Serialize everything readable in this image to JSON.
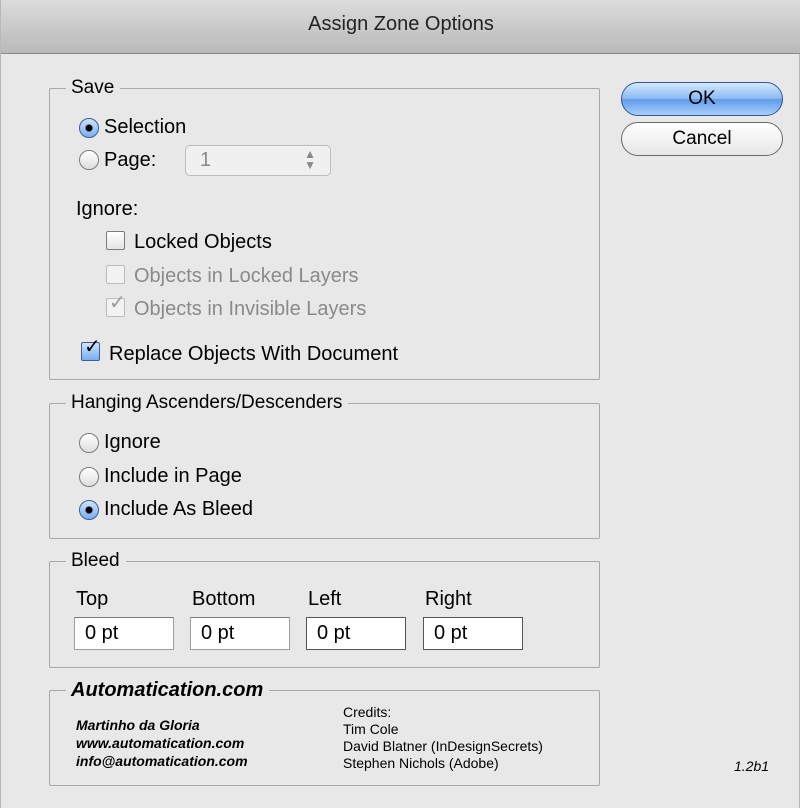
{
  "window": {
    "title": "Assign Zone Options"
  },
  "buttons": {
    "ok": "OK",
    "cancel": "Cancel"
  },
  "save_group": {
    "legend": "Save",
    "selection_label": "Selection",
    "selection_checked": true,
    "page_label": "Page:",
    "page_checked": false,
    "page_value": "1",
    "ignore_label": "Ignore:",
    "locked_objects": {
      "label": "Locked Objects",
      "checked": false,
      "enabled": true
    },
    "objects_locked_layers": {
      "label": "Objects in Locked Layers",
      "checked": false,
      "enabled": false
    },
    "objects_invisible_layers": {
      "label": "Objects in Invisible Layers",
      "checked": true,
      "enabled": false
    },
    "replace_objects": {
      "label": "Replace Objects With Document",
      "checked": true,
      "enabled": true
    }
  },
  "hanging_group": {
    "legend": "Hanging Ascenders/Descenders",
    "options": [
      {
        "label": "Ignore",
        "checked": false
      },
      {
        "label": "Include in Page",
        "checked": false
      },
      {
        "label": "Include As Bleed",
        "checked": true
      }
    ]
  },
  "bleed_group": {
    "legend": "Bleed",
    "top_label": "Top",
    "bottom_label": "Bottom",
    "left_label": "Left",
    "right_label": "Right",
    "top_value": "0 pt",
    "bottom_value": "0 pt",
    "left_value": "0 pt",
    "right_value": "0 pt"
  },
  "credits_group": {
    "legend": "Automatication.com",
    "author_name": "Martinho da Gloria",
    "author_site": "www.automatication.com",
    "author_email": "info@automatication.com",
    "credits_heading": "Credits:",
    "credits": [
      "Tim Cole",
      "David Blatner (InDesignSecrets)",
      "Stephen Nichols (Adobe)"
    ],
    "version": "1.2b1"
  },
  "colors": {
    "accent": "#6fa6ee",
    "window_bg": "#e8e8e8",
    "disabled_text": "#8a8a8a"
  }
}
